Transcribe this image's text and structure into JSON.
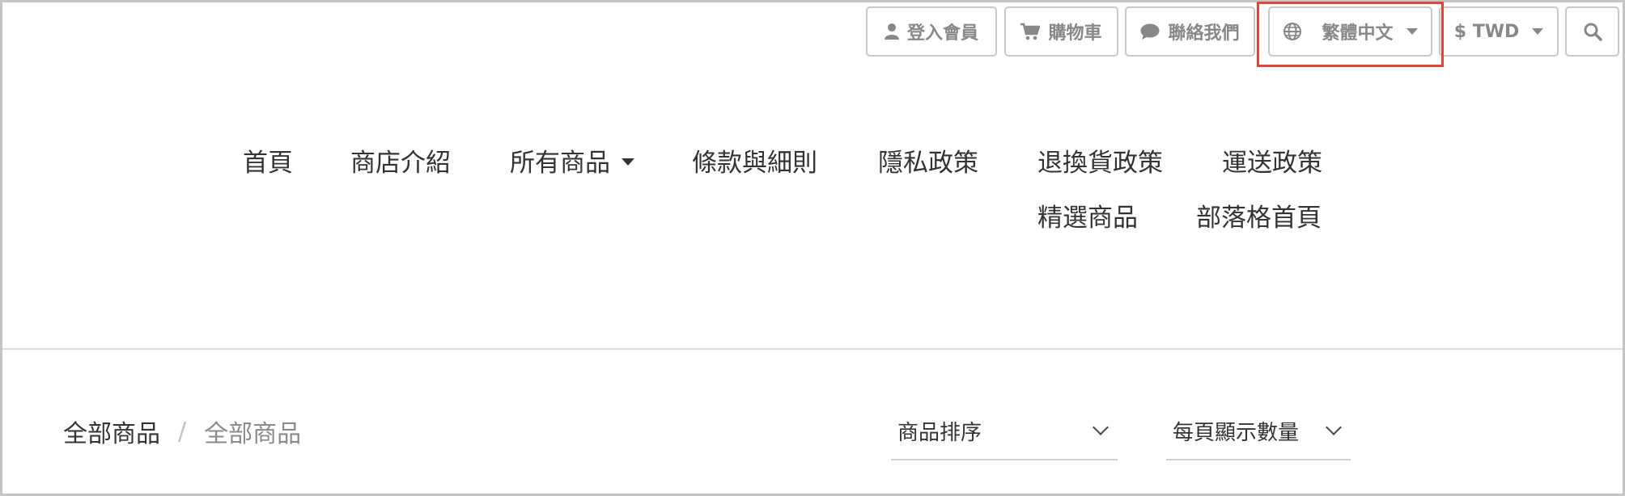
{
  "topbar": {
    "login": "登入會員",
    "cart": "購物車",
    "contact": "聯絡我們",
    "language": "繁體中文",
    "currency": "$ TWD"
  },
  "nav": {
    "home": "首頁",
    "about": "商店介紹",
    "products": "所有商品",
    "terms": "條款與細則",
    "privacy": "隱私政策",
    "returns": "退換貨政策",
    "shipping": "運送政策",
    "featured": "精選商品",
    "blog": "部落格首頁"
  },
  "breadcrumb": {
    "root": "全部商品",
    "separator": "/",
    "current": "全部商品"
  },
  "filters": {
    "sort": "商品排序",
    "per_page": "每頁顯示數量"
  },
  "colors": {
    "highlight": "#e0453a",
    "button_text": "#888888"
  }
}
